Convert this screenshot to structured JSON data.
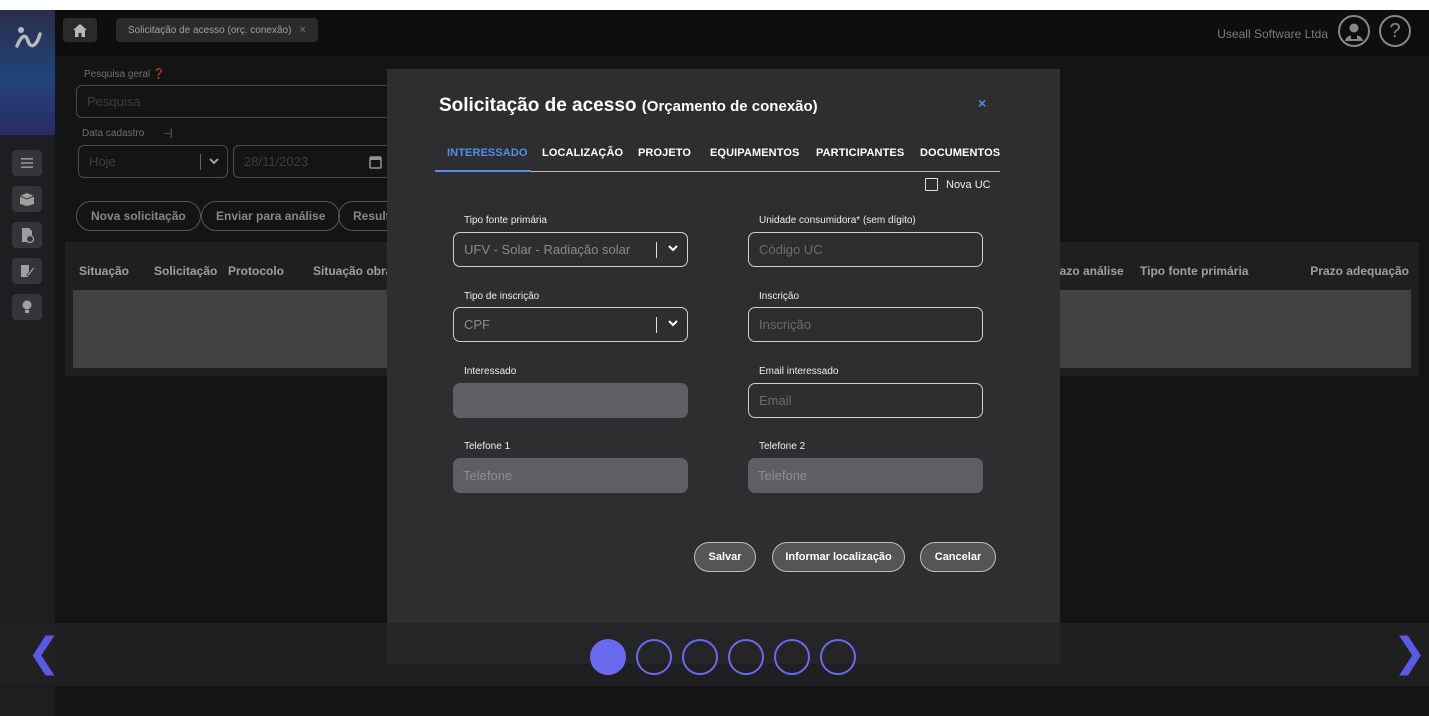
{
  "topbar": {
    "tab_label": "Solicitação de acesso (orç. conexão)",
    "tab_close": "×",
    "company": "Useall Software Ltda",
    "help": "?"
  },
  "background": {
    "search_label": "Pesquisa geral",
    "search_placeholder": "Pesquisa",
    "date_label": "Data cadastro",
    "date_sep": "–|",
    "period_value": "Hoje",
    "date_value": "28/11/2023",
    "buttons": [
      "Nova solicitação",
      "Enviar para análise",
      "Resulta"
    ],
    "table_headers_left": [
      "Situação",
      "Solicitação",
      "Protocolo",
      "Situação obra"
    ],
    "table_headers_right": [
      "razo análise",
      "Tipo fonte primária",
      "Prazo adequação"
    ]
  },
  "modal": {
    "title": "Solicitação de acesso",
    "subtitle": "(Orçamento de conexão)",
    "close": "×",
    "tabs": [
      "INTERESSADO",
      "LOCALIZAÇÃO",
      "PROJETO",
      "EQUIPAMENTOS",
      "PARTICIPANTES",
      "DOCUMENTOS"
    ],
    "nova_uc": "Nova UC",
    "fields": {
      "tipo_fonte": {
        "label": "Tipo fonte primária",
        "value": "UFV - Solar - Radiação solar"
      },
      "unidade": {
        "label": "Unidade consumidora* (sem dígito)",
        "placeholder": "Código UC"
      },
      "tipo_inscricao": {
        "label": "Tipo de inscrição",
        "value": "CPF"
      },
      "inscricao": {
        "label": "Inscrição",
        "placeholder": "Inscrição"
      },
      "interessado": {
        "label": "Interessado",
        "value": ""
      },
      "email": {
        "label": "Email interessado",
        "placeholder": "Email"
      },
      "telefone1": {
        "label": "Telefone 1",
        "placeholder": "Telefone"
      },
      "telefone2": {
        "label": "Telefone 2",
        "placeholder": "Telefone"
      }
    },
    "buttons": {
      "save": "Salvar",
      "locate": "Informar localização",
      "cancel": "Cancelar"
    }
  },
  "carousel": {
    "prev": "❮",
    "next": "❯",
    "pages": 6,
    "active": 1
  },
  "colors": {
    "accent": "#4f8fe8",
    "carousel": "#6a6af0",
    "modal_bg": "#2e2e31"
  }
}
